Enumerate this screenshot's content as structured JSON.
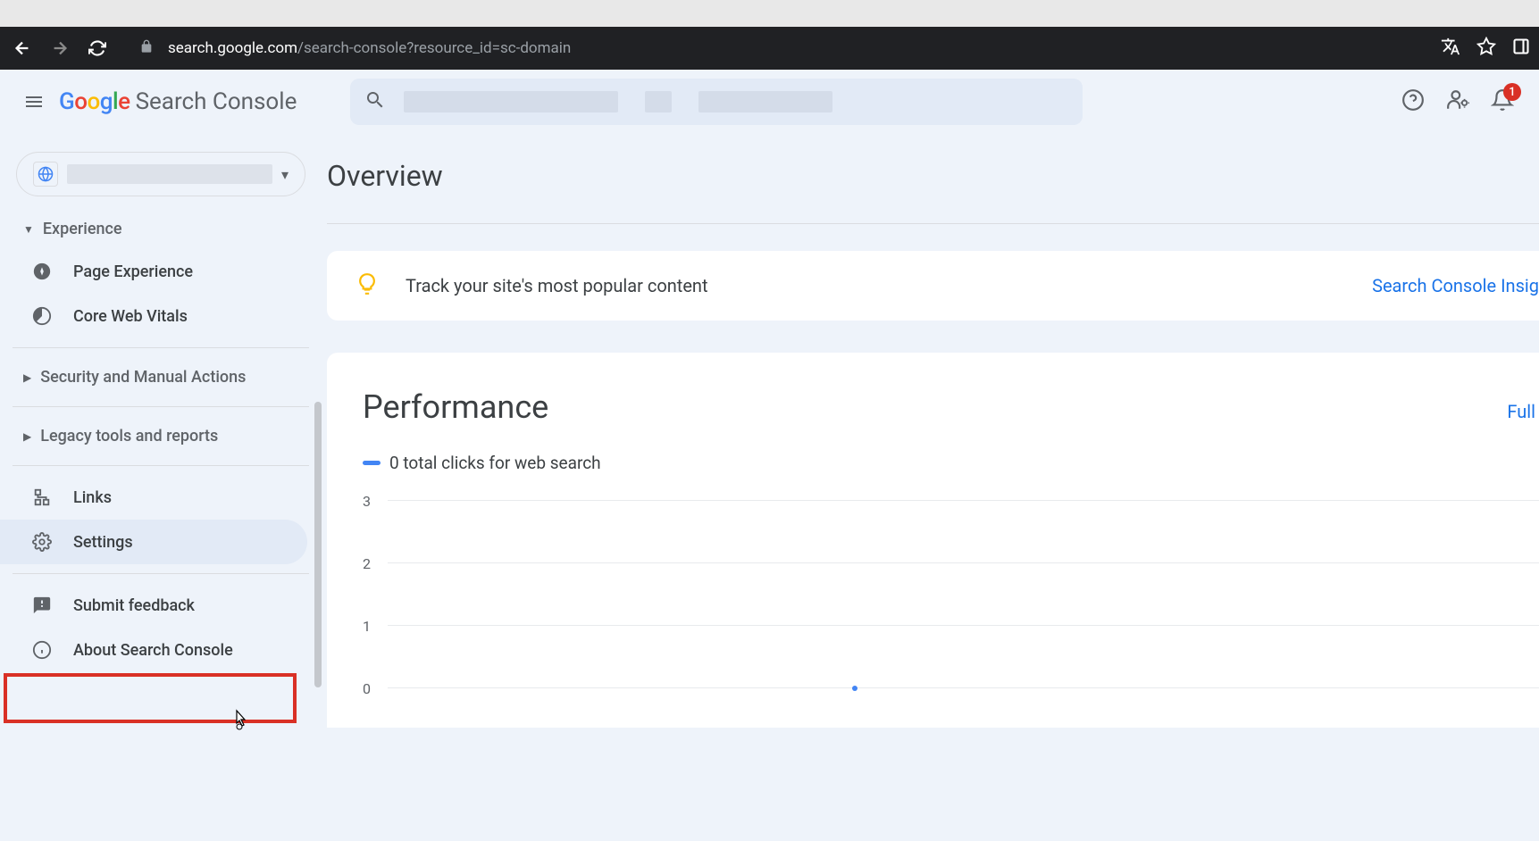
{
  "browser": {
    "url_host": "search.google.com",
    "url_path": "/search-console?resource_id=sc-domain"
  },
  "header": {
    "logo_text": "Search Console",
    "notification_count": "1"
  },
  "sidebar": {
    "experience_label": "Experience",
    "page_experience": "Page Experience",
    "core_web_vitals": "Core Web Vitals",
    "security": "Security and Manual Actions",
    "legacy": "Legacy tools and reports",
    "links": "Links",
    "settings": "Settings",
    "feedback": "Submit feedback",
    "about": "About Search Console"
  },
  "main": {
    "title": "Overview",
    "insights_text": "Track your site's most popular content",
    "insights_link": "Search Console Insig",
    "performance_title": "Performance",
    "performance_link": "Full",
    "legend_text": "0 total clicks for web search"
  },
  "chart_data": {
    "type": "line",
    "title": "Performance",
    "ylabel": "",
    "xlabel": "",
    "ylim": [
      0,
      3
    ],
    "y_ticks": [
      3,
      2,
      1,
      0
    ],
    "series": [
      {
        "name": "total clicks for web search",
        "values": [
          0
        ]
      }
    ]
  }
}
